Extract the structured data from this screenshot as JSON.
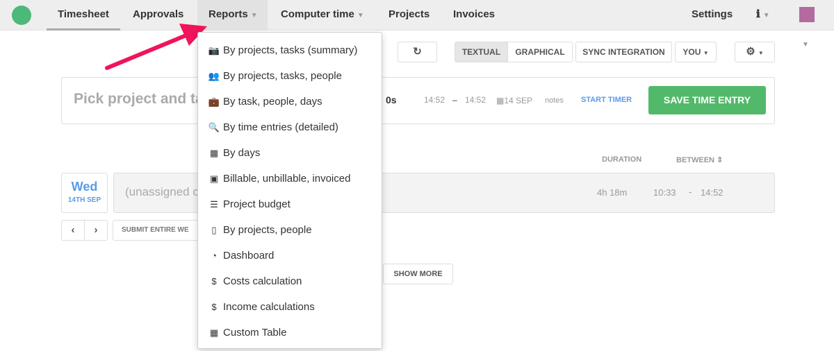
{
  "nav": {
    "items": [
      "Timesheet",
      "Approvals",
      "Reports",
      "Computer time",
      "Projects",
      "Invoices"
    ],
    "settings": "Settings"
  },
  "toolbar": {
    "textual": "TEXTUAL",
    "graphical": "GRAPHICAL",
    "sync": "SYNC INTEGRATION",
    "you": "YOU"
  },
  "entry": {
    "placeholder": "Pick project and ta",
    "duration": "0s",
    "start": "14:52",
    "dash": "–",
    "end": "14:52",
    "date": "14 SEP",
    "notes": "notes",
    "start_timer": "START TIMER",
    "save": "SAVE TIME ENTRY"
  },
  "table": {
    "duration_header": "DURATION",
    "between_header": "BETWEEN"
  },
  "day": {
    "name": "Wed",
    "date": "14TH SEP",
    "task": "(unassigned c",
    "duration": "4h 18m",
    "from": "10:33",
    "dash": "-",
    "to": "14:52"
  },
  "actions": {
    "submit": "SUBMIT ENTIRE WE",
    "show_more": "SHOW MORE"
  },
  "reports_menu": [
    {
      "label": "By projects, tasks (summary)",
      "icon": "camera-icon",
      "glyph": "📷"
    },
    {
      "label": "By projects, tasks, people",
      "icon": "users-icon",
      "glyph": "👥"
    },
    {
      "label": "By task, people, days",
      "icon": "briefcase-icon",
      "glyph": "💼"
    },
    {
      "label": "By time entries (detailed)",
      "icon": "search-icon",
      "glyph": "🔍"
    },
    {
      "label": "By days",
      "icon": "calendar-icon",
      "glyph": "▦"
    },
    {
      "label": "Billable, unbillable, invoiced",
      "icon": "money-icon",
      "glyph": "▣"
    },
    {
      "label": "Project budget",
      "icon": "tasks-icon",
      "glyph": "☰"
    },
    {
      "label": "By projects, people",
      "icon": "file-icon",
      "glyph": "▯"
    },
    {
      "label": "Dashboard",
      "icon": "dashboard-icon",
      "glyph": "◔"
    },
    {
      "label": "Costs calculation",
      "icon": "dollar-icon",
      "glyph": "$"
    },
    {
      "label": "Income calculations",
      "icon": "dollar-icon",
      "glyph": "$"
    },
    {
      "label": "Custom Table",
      "icon": "table-icon",
      "glyph": "▦"
    }
  ],
  "colors": {
    "accent": "#52b96a",
    "link": "#4a90e2",
    "arrow": "#f0145a"
  }
}
